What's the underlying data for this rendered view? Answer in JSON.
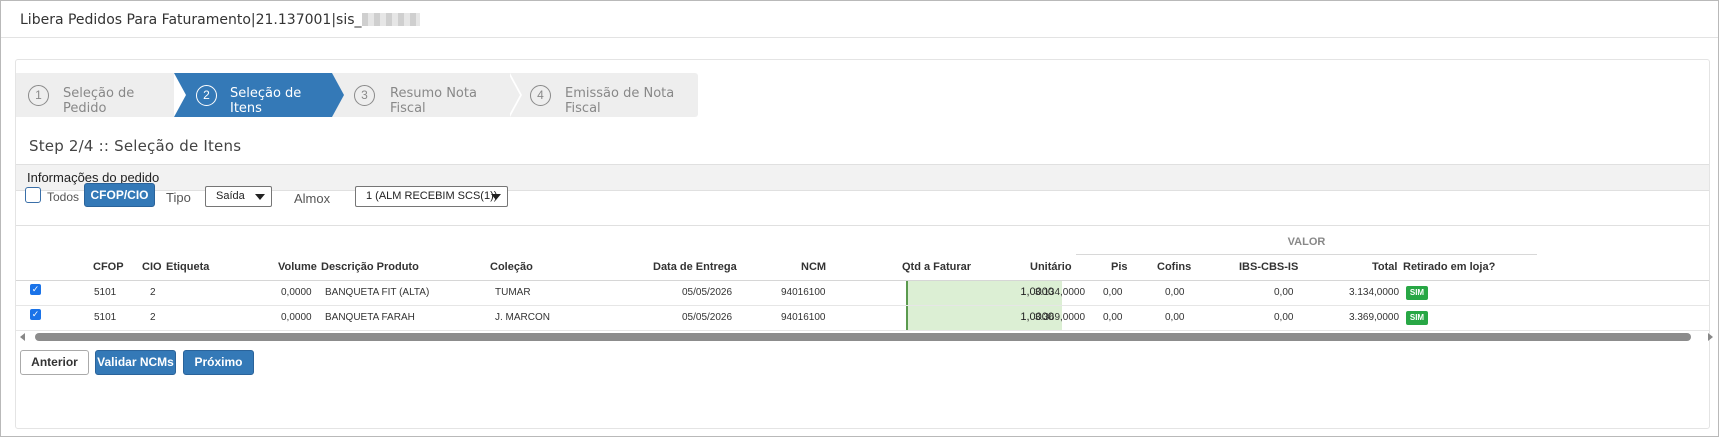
{
  "window": {
    "title": "Libera Pedidos Para Faturamento|21.137001|sis_"
  },
  "wizard": {
    "steps": [
      {
        "num": "1",
        "label": "Seleção de Pedido"
      },
      {
        "num": "2",
        "label": "Seleção de Itens"
      },
      {
        "num": "3",
        "label": "Resumo Nota Fiscal"
      },
      {
        "num": "4",
        "label": "Emissão de Nota Fiscal"
      }
    ],
    "active_step": 2
  },
  "step_title": "Step 2/4 :: Seleção de Itens",
  "section_title": "Informações do pedido",
  "filters": {
    "todos_label": "Todos",
    "cfop_button": "CFOP/CIO",
    "tipo_label": "Tipo",
    "tipo_value": "Saída",
    "almox_label": "Almox",
    "almox_value": "1 (ALM RECEBIM SCS(1))"
  },
  "table": {
    "group_header": "VALOR",
    "columns": {
      "cfop": "CFOP",
      "cio": "CIO",
      "etiqueta": "Etiqueta",
      "volume": "Volume",
      "descricao": "Descrição Produto",
      "colecao": "Coleção",
      "data_entrega": "Data de Entrega",
      "ncm": "NCM",
      "qtd": "Qtd a Faturar",
      "unitario": "Unitário",
      "pis": "Pis",
      "cofins": "Cofins",
      "ibs": "IBS-CBS-IS",
      "total": "Total",
      "retirado": "Retirado em loja?"
    },
    "rows": [
      {
        "checked": true,
        "cfop": "5101",
        "cio": "2",
        "etiqueta": "",
        "volume": "0,0000",
        "descricao": "BANQUETA FIT (ALTA)",
        "colecao": "TUMAR",
        "data_entrega": "05/05/2026",
        "ncm": "94016100",
        "qtd": "1,0000",
        "unitario": "3.134,0000",
        "pis": "0,00",
        "cofins": "0,00",
        "ibs": "0,00",
        "total": "3.134,0000",
        "retirado": "SIM"
      },
      {
        "checked": true,
        "cfop": "5101",
        "cio": "2",
        "etiqueta": "",
        "volume": "0,0000",
        "descricao": "BANQUETA FARAH",
        "colecao": "J. MARCON",
        "data_entrega": "05/05/2026",
        "ncm": "94016100",
        "qtd": "1,0000",
        "unitario": "3.369,0000",
        "pis": "0,00",
        "cofins": "0,00",
        "ibs": "0,00",
        "total": "3.369,0000",
        "retirado": "SIM"
      }
    ]
  },
  "footer": {
    "anterior": "Anterior",
    "validar": "Validar NCMs",
    "proximo": "Próximo"
  },
  "colors": {
    "primary": "#3479b7",
    "success": "#28a745",
    "qty_bg": "#dcefd4"
  }
}
